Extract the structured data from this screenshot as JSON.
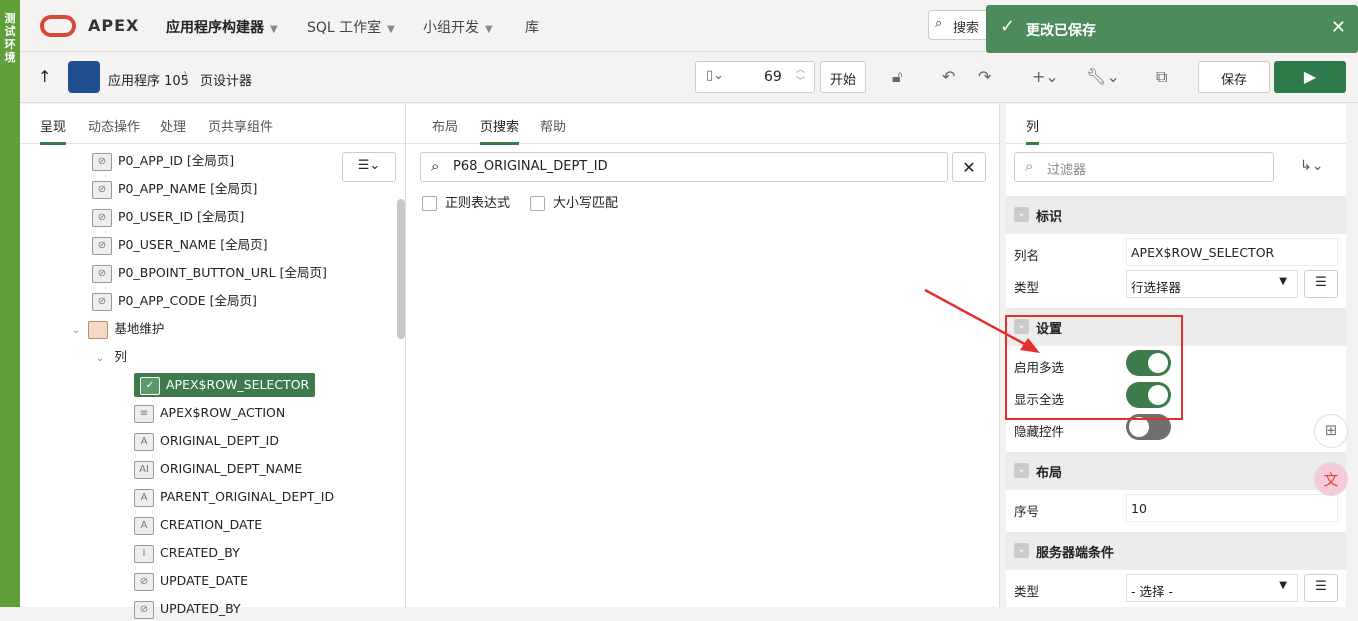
{
  "env_badge": "测试环境",
  "brand": "APEX",
  "nav": [
    "应用程序构建器",
    "SQL 工作室",
    "小组开发",
    "库"
  ],
  "search_label": "搜索",
  "toast": "更改已保存",
  "breadcrumb": {
    "app": "应用程序 105",
    "sep": "\\",
    "page": "页设计器"
  },
  "page_number": "69",
  "start_label": "开始",
  "save_label": "保存",
  "left_tabs": [
    "呈现",
    "动态操作",
    "处理",
    "页共享组件"
  ],
  "tree": [
    {
      "label": "P0_APP_ID [全局页]",
      "icon": "hidden-icon"
    },
    {
      "label": "P0_APP_NAME [全局页]",
      "icon": "hidden-icon"
    },
    {
      "label": "P0_USER_ID [全局页]",
      "icon": "hidden-icon"
    },
    {
      "label": "P0_USER_NAME [全局页]",
      "icon": "hidden-icon"
    },
    {
      "label": "P0_BPOINT_BUTTON_URL [全局页]",
      "icon": "hidden-icon"
    },
    {
      "label": "P0_APP_CODE [全局页]",
      "icon": "hidden-icon"
    },
    {
      "label": "基地维护",
      "icon": "region-icon"
    },
    {
      "label": "列",
      "icon": ""
    },
    {
      "label": "APEX$ROW_SELECTOR",
      "icon": "checkbox-icon"
    },
    {
      "label": "APEX$ROW_ACTION",
      "icon": "doc-icon"
    },
    {
      "label": "ORIGINAL_DEPT_ID",
      "icon": "text-icon"
    },
    {
      "label": "ORIGINAL_DEPT_NAME",
      "icon": "textfield-icon"
    },
    {
      "label": "PARENT_ORIGINAL_DEPT_ID",
      "icon": "text-icon"
    },
    {
      "label": "CREATION_DATE",
      "icon": "text-icon"
    },
    {
      "label": "CREATED_BY",
      "icon": "textfield-icon"
    },
    {
      "label": "UPDATE_DATE",
      "icon": "hidden-icon"
    },
    {
      "label": "UPDATED_BY",
      "icon": "hidden-icon"
    }
  ],
  "mid_tabs": [
    "布局",
    "页搜索",
    "帮助"
  ],
  "mid_search_value": "P68_ORIGINAL_DEPT_ID",
  "checkbox_regex": "正则表达式",
  "checkbox_case": "大小写匹配",
  "right_tab": "列",
  "filter_placeholder": "过滤器",
  "sections": {
    "identification": "标识",
    "settings": "设置",
    "layout": "布局",
    "server_condition": "服务器端条件"
  },
  "props": {
    "col_name_label": "列名",
    "col_name_value": "APEX$ROW_SELECTOR",
    "type_label": "类型",
    "type_value": "行选择器",
    "multi_label": "启用多选",
    "multi_on": true,
    "selectall_label": "显示全选",
    "selectall_on": true,
    "hide_label": "隐藏控件",
    "hide_on": false,
    "seq_label": "序号",
    "seq_value": "10",
    "cond_type_label": "类型",
    "cond_type_value": "- 选择 -"
  }
}
